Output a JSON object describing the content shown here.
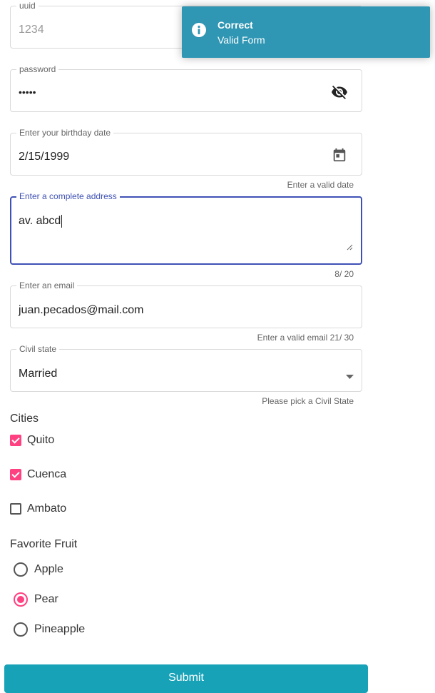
{
  "uuid_field": {
    "label": "uuid",
    "placeholder": "1234"
  },
  "password_field": {
    "label": "password",
    "value": "•••••",
    "toggle_icon": "eye-off-icon"
  },
  "birthday_field": {
    "label": "Enter your birthday date",
    "value": "2/15/1999",
    "hint": "Enter a valid date",
    "icon": "calendar-icon"
  },
  "address_field": {
    "label": "Enter a complete address",
    "value": "av. abcd",
    "counter": "8/ 20"
  },
  "email_field": {
    "label": "Enter an email",
    "value": "juan.pecados@mail.com",
    "hint": "Enter a valid email 21/ 30"
  },
  "civil_field": {
    "label": "Civil state",
    "value": "Married",
    "hint": "Please pick a Civil State",
    "icon": "dropdown-arrow-icon"
  },
  "cities": {
    "title": "Cities",
    "options": [
      {
        "label": "Quito",
        "checked": true
      },
      {
        "label": "Cuenca",
        "checked": true
      },
      {
        "label": "Ambato",
        "checked": false
      }
    ]
  },
  "fruit": {
    "title": "Favorite Fruit",
    "options": [
      {
        "label": "Apple",
        "selected": false
      },
      {
        "label": "Pear",
        "selected": true
      },
      {
        "label": "Pineapple",
        "selected": false
      }
    ]
  },
  "submit_label": "Submit",
  "toast": {
    "title": "Correct",
    "message": "Valid Form",
    "icon": "info-icon"
  },
  "colors": {
    "accent": "#ff4081",
    "focus": "#3f51b5",
    "submit": "#17a2b8",
    "toast": "#2f96b4"
  }
}
